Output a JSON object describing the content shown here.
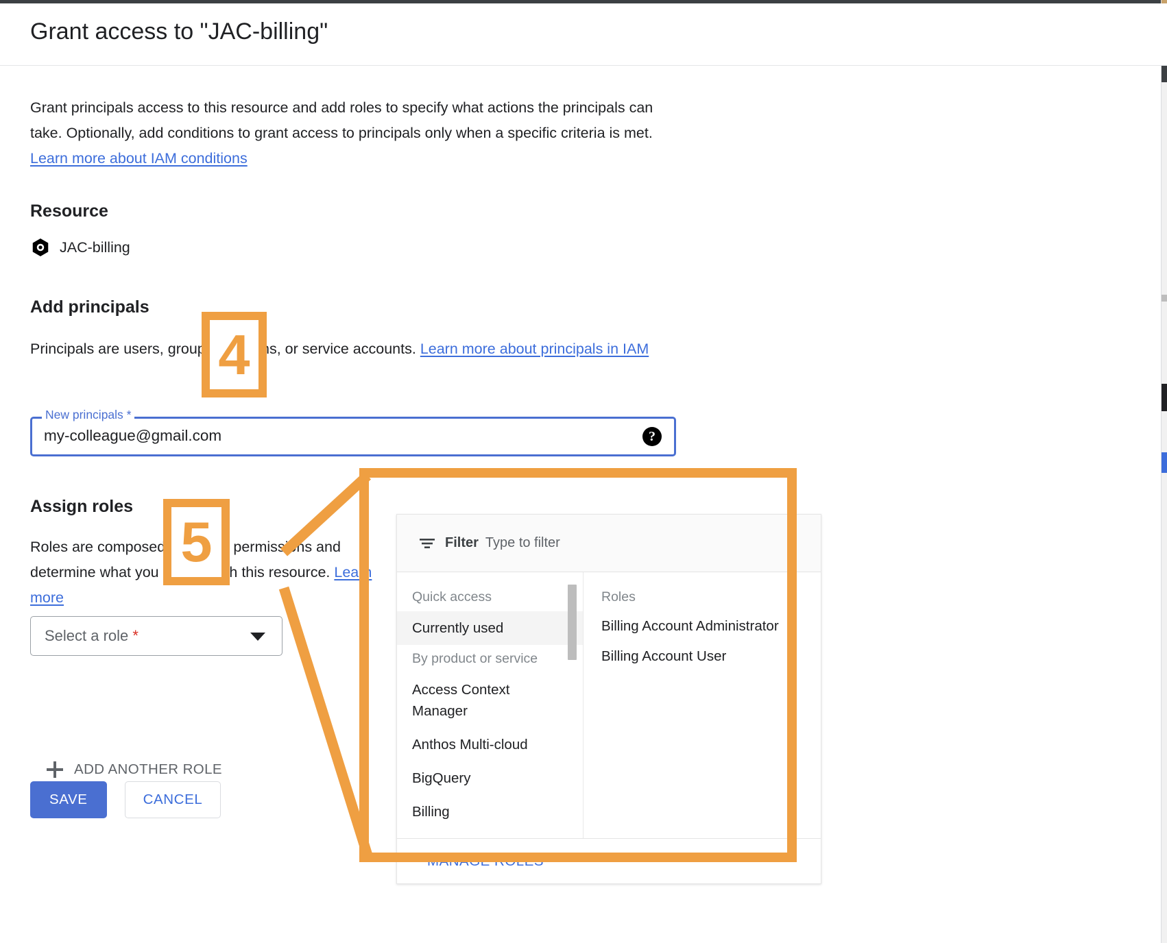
{
  "dialog": {
    "title": "Grant access to \"JAC-billing\"",
    "intro_text_1": "Grant principals access to this resource and add roles to specify what actions the principals can take. Optionally, add conditions to grant access to principals only when a specific criteria is met. ",
    "intro_link": "Learn more about IAM conditions"
  },
  "resource": {
    "heading": "Resource",
    "icon": "billing-account-hex-icon",
    "name": "JAC-billing"
  },
  "add_principals": {
    "heading": "Add principals",
    "description_1": "Principals are users, groups, domains, or service accounts. ",
    "description_link": "Learn more about principals in IAM",
    "field_label": "New principals *",
    "field_value": "my-colleague@gmail.com",
    "help_icon": "help-question-icon"
  },
  "assign_roles": {
    "heading": "Assign roles",
    "description_1": "Roles are composed of sets of permissions and determine what you can do with this resource. ",
    "description_link": "Learn more",
    "select_placeholder": "Select a role",
    "select_required_marker": "*",
    "caret_icon": "chevron-down-icon",
    "add_another_role": "ADD ANOTHER ROLE",
    "add_icon": "plus-icon"
  },
  "actions": {
    "save": "SAVE",
    "cancel": "CANCEL"
  },
  "role_picker": {
    "filter_icon": "filter-icon",
    "filter_label": "Filter",
    "filter_placeholder": "Type to filter",
    "left_column": {
      "group_1_label": "Quick access",
      "group_1_items": [
        "Currently used"
      ],
      "selected_item": "Currently used",
      "group_2_label": "By product or service",
      "group_2_items": [
        "Access Context Manager",
        "Anthos Multi-cloud",
        "BigQuery",
        "Billing"
      ]
    },
    "right_column": {
      "label": "Roles",
      "items": [
        "Billing Account Administrator",
        "Billing Account User"
      ]
    },
    "footer_link": "MANAGE ROLES",
    "scrollbar": "vertical-scrollbar"
  },
  "annotations": {
    "color": "#ef9f42",
    "step_4": "4",
    "step_5": "5"
  },
  "colors": {
    "accent_blue": "#4a6fd1",
    "link_blue": "#3c6ddb",
    "required_red": "#d93025",
    "annotation_orange": "#ef9f42"
  }
}
